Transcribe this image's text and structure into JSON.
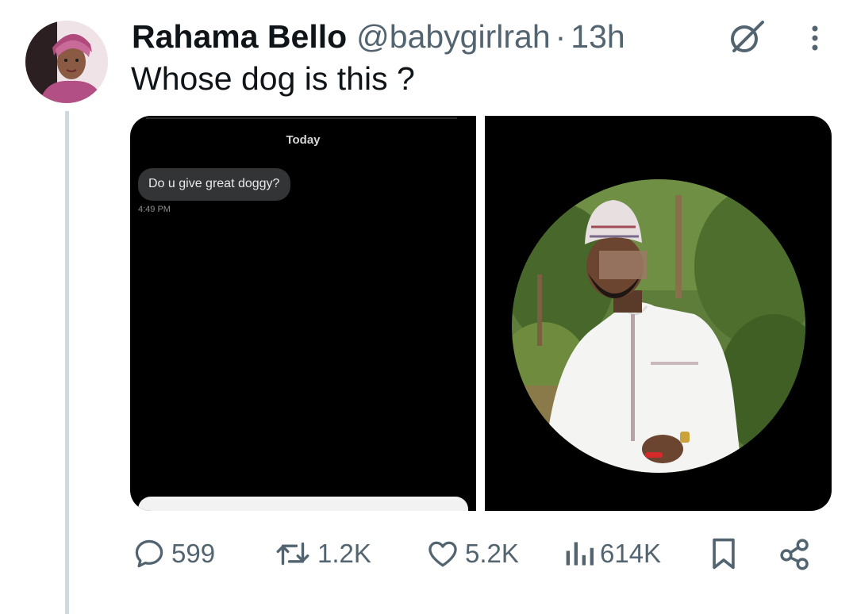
{
  "tweet": {
    "display_name": "Rahama Bello",
    "handle": "@babygirlrah",
    "separator": "·",
    "time": "13h",
    "text": "Whose dog is this ?",
    "grok_icon": "grok-icon",
    "more_icon": "more-vertical-icon"
  },
  "media": {
    "screenshot": {
      "day_label": "Today",
      "message": "Do u give great doggy?",
      "message_time": "4:49 PM"
    },
    "photo": {
      "description_icon": "profile-photo"
    }
  },
  "actions": {
    "replies": {
      "icon": "reply-icon",
      "count": "599"
    },
    "reposts": {
      "icon": "repost-icon",
      "count": "1.2K"
    },
    "likes": {
      "icon": "heart-icon",
      "count": "5.2K"
    },
    "views": {
      "icon": "views-icon",
      "count": "614K"
    },
    "bookmark": {
      "icon": "bookmark-icon"
    },
    "share": {
      "icon": "share-icon"
    }
  },
  "colors": {
    "text_primary": "#0f1419",
    "text_secondary": "#536471",
    "thread_line": "#cfd9de",
    "media_bg": "#000000"
  }
}
